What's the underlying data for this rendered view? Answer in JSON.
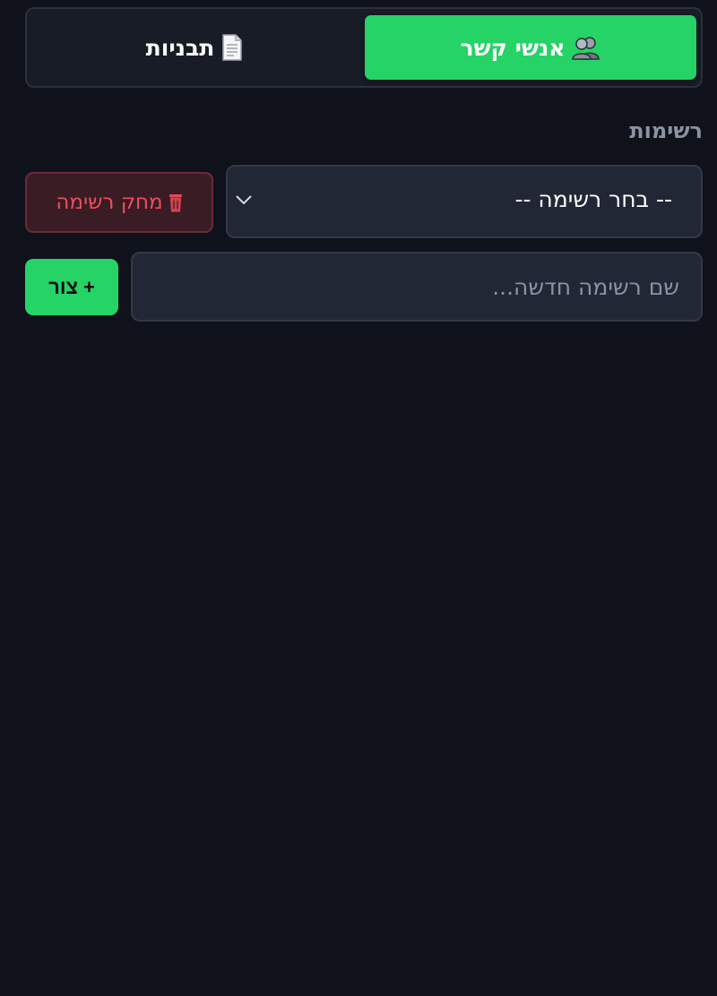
{
  "tabs": {
    "contacts": {
      "label": "אנשי קשר",
      "icon": "people-icon",
      "active": true
    },
    "templates": {
      "label": "תבניות",
      "icon": "document-icon",
      "active": false
    }
  },
  "lists": {
    "section_label": "רשימות",
    "select": {
      "value": "-- בחר רשימה --"
    },
    "delete_button": {
      "label": "מחק רשימה",
      "icon": "trash-icon"
    },
    "new_list": {
      "placeholder": "שם רשימה חדשה...",
      "value": "",
      "create_label": "+ צור"
    }
  },
  "colors": {
    "background": "#0f121a",
    "accent": "#25d366",
    "danger": "#f04d5b"
  }
}
